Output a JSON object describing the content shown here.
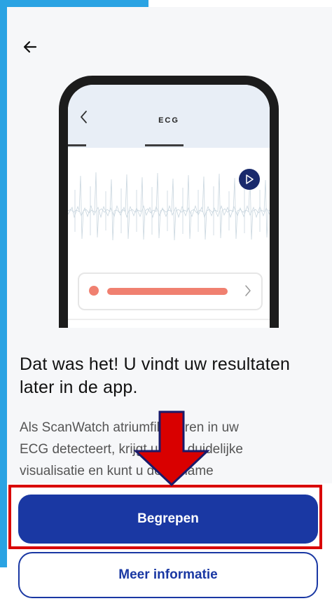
{
  "illustration": {
    "screen_title": "ECG"
  },
  "content": {
    "headline": "Dat was het! U vindt uw resultaten later in de app.",
    "body_line1": "Als ScanWatch atriumfibrilleren in uw",
    "body_line2": "ECG detecteert, krijgt u een duidelijke",
    "body_line3": "visualisatie en kunt u de opname"
  },
  "actions": {
    "primary_label": "Begrepen",
    "secondary_label": "Meer informatie"
  },
  "colors": {
    "accent": "#1a38a3",
    "frame": "#2aa3e3",
    "annotation": "#d90000",
    "result": "#f08070"
  },
  "icons": {
    "back": "arrow-left-icon",
    "phone_back": "chevron-left-icon",
    "play": "play-icon",
    "chevron": "chevron-right-icon"
  }
}
